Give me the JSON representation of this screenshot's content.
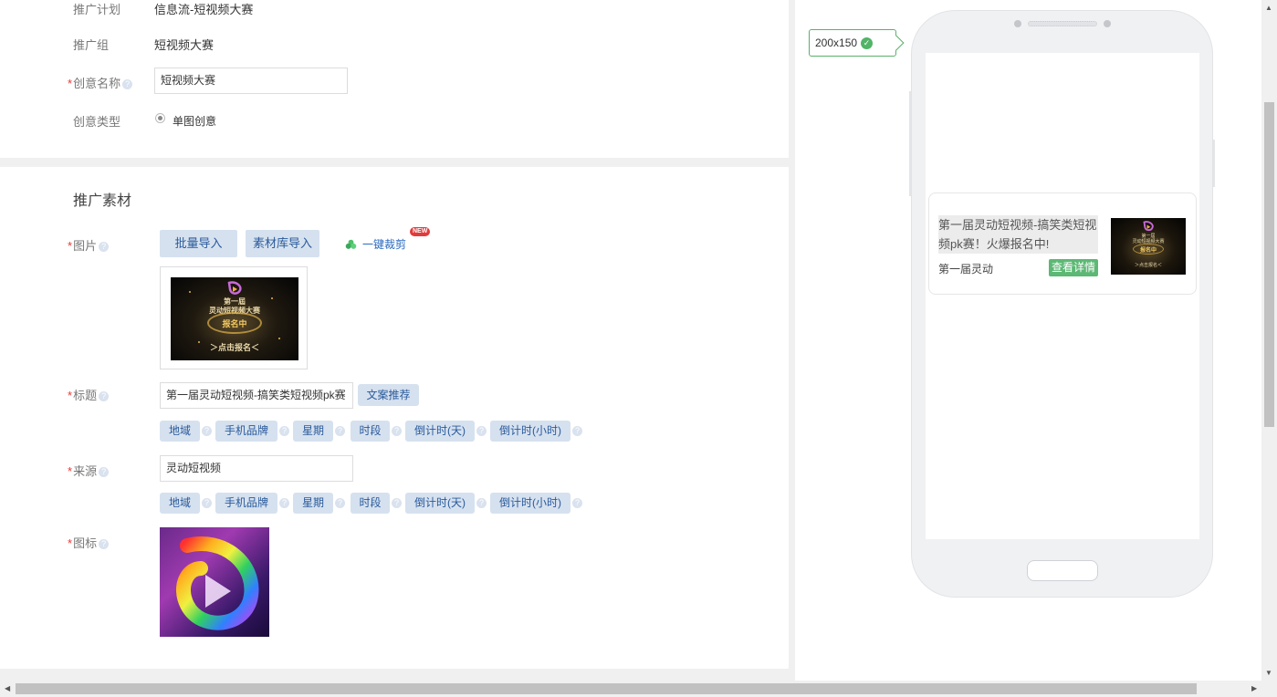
{
  "form": {
    "plan_label": "推广计划",
    "plan_value": "信息流-短视频大赛",
    "group_label": "推广组",
    "group_value": "短视频大赛",
    "creative_name_label": "创意名称",
    "creative_name_value": "短视频大赛",
    "creative_type_label": "创意类型",
    "creative_type_option": "单图创意",
    "required_mark": "*",
    "help_glyph": "?"
  },
  "material": {
    "section_title": "推广素材",
    "image_label": "图片",
    "batch_import": "批量导入",
    "library_import": "素材库导入",
    "one_click_crop": "一键裁剪",
    "new_badge": "NEW",
    "promo_image_text": {
      "line1": "第一屆",
      "line2": "灵动短视频大赛",
      "line3": "报名中",
      "line4": "＞点击报名＜"
    },
    "title_label": "标题",
    "title_value": "第一届灵动短视频-搞笑类短视频pk赛",
    "copy_recommend": "文案推荐",
    "title_tags": [
      "地域",
      "手机品牌",
      "星期",
      "时段",
      "倒计时(天)",
      "倒计时(小时)"
    ],
    "source_label": "来源",
    "source_value": "灵动短视频",
    "source_tags": [
      "地域",
      "手机品牌",
      "星期",
      "时段",
      "倒计时(天)",
      "倒计时(小时)"
    ],
    "icon_label": "图标"
  },
  "preview": {
    "size_tag": "200x150",
    "ad_title": "第一届灵动短视频-搞笑类短视频pk赛！火爆报名中!",
    "ad_source": "第一届灵动",
    "ad_button": "查看详情"
  },
  "colors": {
    "accent_green": "#5cb874",
    "button_bg": "#d6e1ef",
    "button_text": "#2a5a9b",
    "required_red": "#e33333"
  }
}
